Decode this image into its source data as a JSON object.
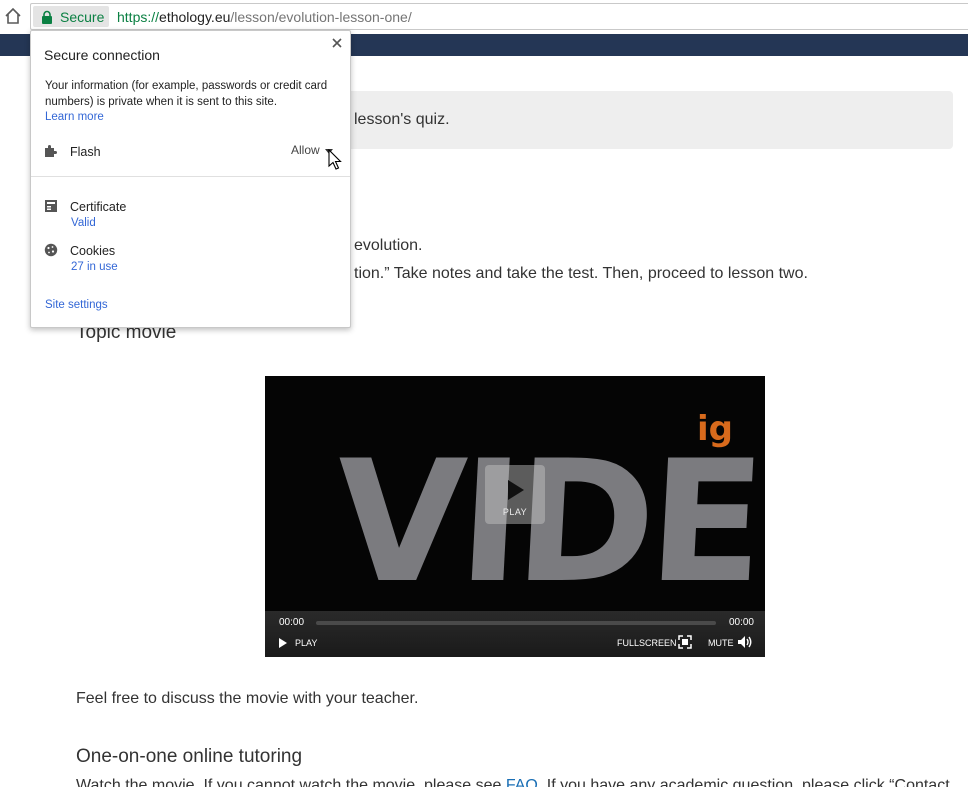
{
  "browser": {
    "secure_label": "Secure",
    "url_scheme": "https://",
    "url_host": "ethology.eu",
    "url_path": "/lesson/evolution-lesson-one/",
    "colors": {
      "secure_green": "#0b8043",
      "header_navy": "#243655"
    }
  },
  "popup": {
    "title": "Secure connection",
    "description": "Your information (for example, passwords or credit card numbers) is private when it is sent to this site.",
    "learn_more": "Learn more",
    "flash_label": "Flash",
    "flash_value": "Allow",
    "certificate_label": "Certificate",
    "certificate_status": "Valid",
    "cookies_label": "Cookies",
    "cookies_count": "27 in use",
    "site_settings": "Site settings",
    "icons": {
      "close": "close-icon",
      "flash": "puzzle-piece-icon",
      "certificate": "certificate-icon",
      "cookies": "cookie-icon"
    }
  },
  "page": {
    "notice_text": "lesson's quiz.",
    "intro_line1": "evolution.",
    "intro_line2": "tion.” Take notes and take the test. Then, proceed to lesson two.",
    "topic_heading": "Topic movie",
    "discuss_text": "Feel free to discuss the movie with your teacher.",
    "tutoring_heading": "One-on-one online tutoring",
    "tutoring_text_before": "Watch the movie. If you cannot watch the movie, please see ",
    "tutoring_link": "FAQ",
    "tutoring_text_after": ". If you have any academic question, please click “Contact"
  },
  "video": {
    "poster_text": "VIDEO",
    "brand_mark": "ig",
    "play_overlay_label": "PLAY",
    "current_time": "00:00",
    "duration": "00:00",
    "play_label": "PLAY",
    "fullscreen_label": "FULLSCREEN",
    "mute_label": "MUTE",
    "progress": 0
  }
}
